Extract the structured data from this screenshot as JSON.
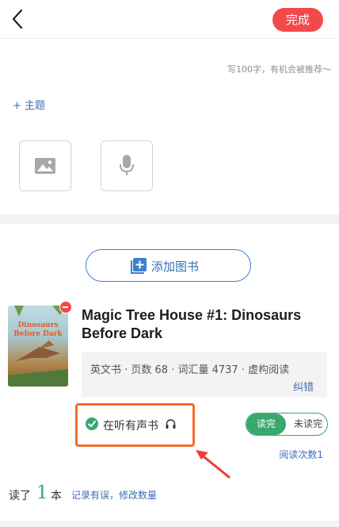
{
  "header": {
    "done_label": "完成"
  },
  "editor": {
    "hint": "写100字，有机会被推荐～",
    "topic_label": "+ 主题"
  },
  "media": {
    "image_icon": "image-icon",
    "mic_icon": "microphone-icon"
  },
  "add_book": {
    "label": "添加图书"
  },
  "book": {
    "title": "Magic Tree House #1: Dinosaurs Before Dark",
    "cover_line1": "Dinosaurs",
    "cover_line2": "Before Dark",
    "info": "英文书 · 页数 68 · 词汇量 4737 · 虚构阅读",
    "fix_label": "纠错",
    "listening_label": "在听有声书",
    "status": {
      "selected": "读完",
      "other": "未读完"
    },
    "read_times": "阅读次数1"
  },
  "read_count": {
    "prefix": "读了",
    "count": "1",
    "suffix": "本",
    "edit_link": "记录有误，修改数量"
  },
  "colors": {
    "accent_red": "#f24a4a",
    "accent_green": "#3aa76d",
    "link_blue": "#3b6fb5",
    "highlight_orange": "#f36a2d"
  }
}
